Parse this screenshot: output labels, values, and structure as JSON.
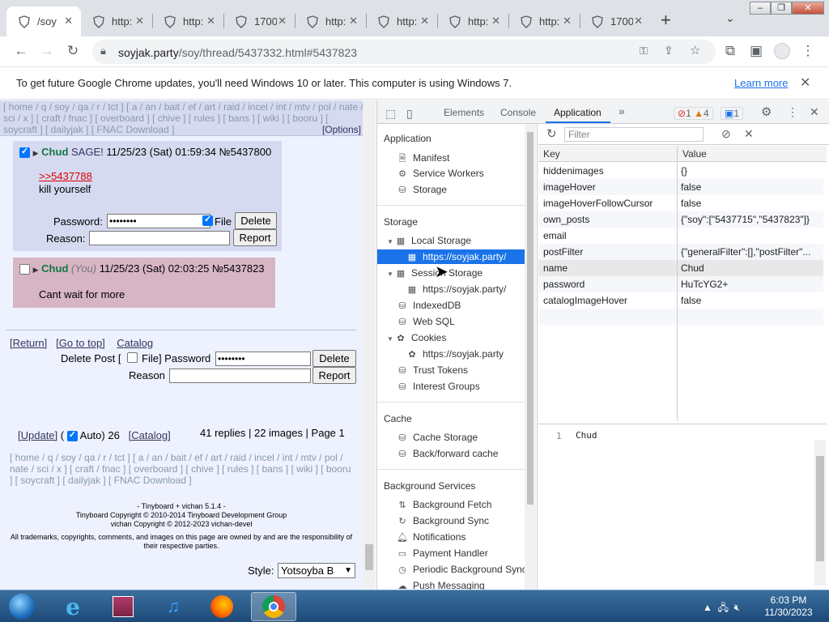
{
  "browser": {
    "tabs": [
      {
        "title": "/soy",
        "active": true
      },
      {
        "title": "http:",
        "active": false
      },
      {
        "title": "http:",
        "active": false
      },
      {
        "title": "1700",
        "active": false
      },
      {
        "title": "http:",
        "active": false
      },
      {
        "title": "http:",
        "active": false
      },
      {
        "title": "http:",
        "active": false
      },
      {
        "title": "http:",
        "active": false
      },
      {
        "title": "1700",
        "active": false
      }
    ],
    "url_host": "soyjak.party",
    "url_path": "/soy/thread/5437332.html#5437823",
    "infobar_text": "To get future Google Chrome updates, you'll need Windows 10 or later. This computer is using Windows 7.",
    "infobar_link": "Learn more"
  },
  "page": {
    "boardlist_top": "[ home / q / soy / qa / r / tct ] [ a / an / bait / ef / art / raid / incel / int / mtv / pol / nate / sci / x ] [ craft / fnac ] [ overboard ] [ chive ] [ rules ] [ bans ] [ wiki ] [ booru ] [ soycraft ] [ dailyjak ] [ FNAC Download ]",
    "options": "[Options]",
    "post1": {
      "name": "Chud",
      "email": "SAGE!",
      "date": "11/25/23 (Sat) 01:59:34",
      "no": "№5437800",
      "quote": ">>5437788",
      "text": "kill yourself",
      "password_label": "Password:",
      "password_value": "••••••••",
      "file_label": "File",
      "delete": "Delete",
      "reason_label": "Reason:",
      "report": "Report"
    },
    "post2": {
      "name": "Chud",
      "you": "(You)",
      "date": "11/25/23 (Sat) 02:03:25",
      "no": "№5437823",
      "text": "Cant wait for more"
    },
    "nav": {
      "return": "[Return]",
      "top": "[Go to top]",
      "catalog": "Catalog"
    },
    "delete_form": {
      "delete_post": "Delete Post [",
      "file": "File] Password",
      "password_value": "••••••••",
      "delete": "Delete",
      "reason": "Reason",
      "report": "Report"
    },
    "footer_nav": {
      "update": "[Update]",
      "auto_open": "(",
      "auto": "Auto) 26",
      "catalog": "[Catalog]",
      "stats": "41 replies | 22 images | Page 1"
    },
    "boardlist_bottom": "[ home / q / soy / qa / r / tct ] [ a / an / bait / ef / art / raid / incel / int / mtv / pol / nate / sci / x ] [ craft / fnac ] [ overboard ] [ chive ] [ rules ] [ bans ] [ wiki ] [ booru ] [ soycraft ] [ dailyjak ] [ FNAC Download ]",
    "credits": [
      "- Tinyboard + vichan 5.1.4 -",
      "Tinyboard Copyright © 2010-2014 Tinyboard Development Group",
      "vichan Copyright © 2012-2023 vichan-devel",
      "All trademarks, copyrights, comments, and images on this page are owned by and are the responsibility of their respective parties."
    ],
    "style_label": "Style:",
    "style_value": "Yotsoyba B"
  },
  "devtools": {
    "tabs": [
      "Elements",
      "Console",
      "Application"
    ],
    "selected_tab": "Application",
    "errors": "1",
    "warnings": "4",
    "messages": "1",
    "sidebar": {
      "application_header": "Application",
      "application_items": [
        "Manifest",
        "Service Workers",
        "Storage"
      ],
      "storage_header": "Storage",
      "local_storage": "Local Storage",
      "local_storage_origin": "https://soyjak.party/",
      "session_storage": "Session Storage",
      "session_storage_origin": "https://soyjak.party/",
      "storage_items": [
        "IndexedDB",
        "Web SQL"
      ],
      "cookies": "Cookies",
      "cookies_origin": "https://soyjak.party",
      "storage_items2": [
        "Trust Tokens",
        "Interest Groups"
      ],
      "cache_header": "Cache",
      "cache_items": [
        "Cache Storage",
        "Back/forward cache"
      ],
      "bg_header": "Background Services",
      "bg_items": [
        "Background Fetch",
        "Background Sync",
        "Notifications",
        "Payment Handler",
        "Periodic Background Sync",
        "Push Messaging"
      ]
    },
    "filter_placeholder": "Filter",
    "columns": {
      "key": "Key",
      "value": "Value"
    },
    "rows": [
      {
        "key": "hiddenimages",
        "value": "{}"
      },
      {
        "key": "imageHover",
        "value": "false"
      },
      {
        "key": "imageHoverFollowCursor",
        "value": "false"
      },
      {
        "key": "own_posts",
        "value": "{\"soy\":[\"5437715\",\"5437823\"]}"
      },
      {
        "key": "email",
        "value": ""
      },
      {
        "key": "postFilter",
        "value": "{\"generalFilter\":[],\"postFilter\"..."
      },
      {
        "key": "name",
        "value": "Chud"
      },
      {
        "key": "password",
        "value": "HuTcYG2+"
      },
      {
        "key": "catalogImageHover",
        "value": "false"
      }
    ],
    "preview_line_no": "1",
    "preview_value": "Chud"
  },
  "taskbar": {
    "time": "6:03 PM",
    "date": "11/30/2023"
  }
}
